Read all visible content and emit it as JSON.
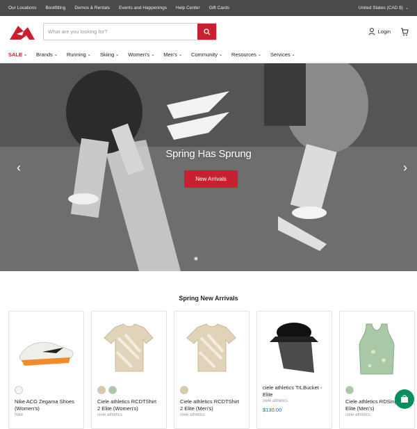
{
  "topbar": {
    "links": [
      "Our Locations",
      "Bootfitting",
      "Demos & Rentals",
      "Events and Happenings",
      "Help Center",
      "Gift Cards"
    ],
    "region": "United States (CAD $)"
  },
  "header": {
    "search_placeholder": "What are you looking for?",
    "login_label": "Login"
  },
  "nav": [
    "SALE",
    "Brands",
    "Running",
    "Skiing",
    "Women's",
    "Men's",
    "Community",
    "Resources",
    "Services"
  ],
  "hero": {
    "title": "Spring Has Sprung",
    "button_label": "New Arrivals"
  },
  "section": {
    "title": "Spring New Arrivals"
  },
  "products": [
    {
      "name": "Nike ACG Zegama Shoes (Women's)",
      "brand": "Nike",
      "price": "",
      "swatches": [
        "#f4f4f4"
      ]
    },
    {
      "name": "Ciele athletics RCDTShirt 2 Elite (Women's)",
      "brand": "ciele athletics",
      "price": "",
      "swatches": [
        "#d9c9a8",
        "#a8c8a6"
      ]
    },
    {
      "name": "Ciele athletics RCDTShirt 2 Elite (Men's)",
      "brand": "ciele athletics",
      "price": "",
      "swatches": [
        "#d9c9a8"
      ]
    },
    {
      "name": "ciele athletics TrLBucket - Elite",
      "brand": "ciele athletics",
      "price": "$130.00",
      "swatches": []
    },
    {
      "name": "Ciele athletics RDSinglet Elite (Men's)",
      "brand": "ciele athletics",
      "price": "",
      "swatches": [
        "#a8c8a6"
      ]
    }
  ],
  "colors": {
    "brand_red": "#c8202f",
    "topbar": "#4a4a4a",
    "price_blue": "#1565c0",
    "chat_green": "#0a8f5c"
  }
}
